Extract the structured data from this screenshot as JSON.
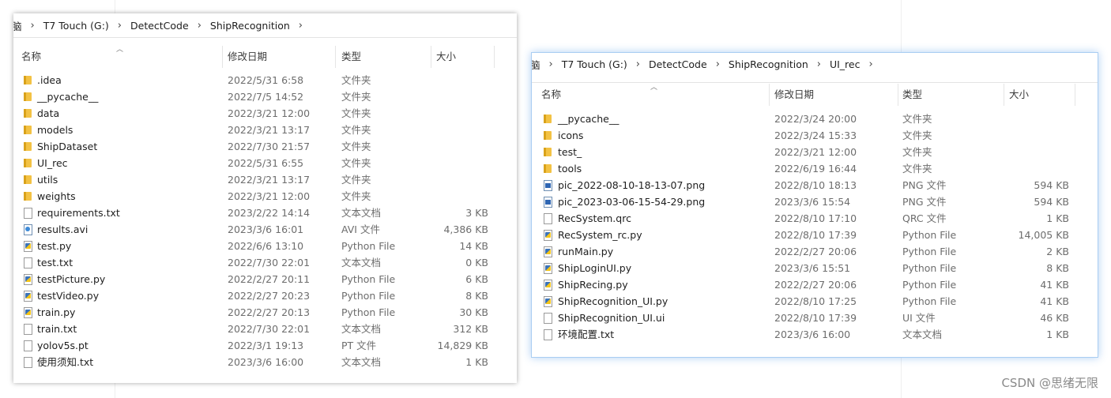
{
  "left": {
    "breadcrumb": [
      "脑",
      "T7 Touch (G:)",
      "DetectCode",
      "ShipRecognition"
    ],
    "columns": {
      "name": "名称",
      "modified": "修改日期",
      "type": "类型",
      "size": "大小"
    },
    "rows": [
      {
        "icon": "folder",
        "name": ".idea",
        "date": "2022/5/31 6:58",
        "type": "文件夹",
        "size": ""
      },
      {
        "icon": "folder",
        "name": "__pycache__",
        "date": "2022/7/5 14:52",
        "type": "文件夹",
        "size": ""
      },
      {
        "icon": "folder",
        "name": "data",
        "date": "2022/3/21 12:00",
        "type": "文件夹",
        "size": ""
      },
      {
        "icon": "folder",
        "name": "models",
        "date": "2022/3/21 13:17",
        "type": "文件夹",
        "size": ""
      },
      {
        "icon": "folder",
        "name": "ShipDataset",
        "date": "2022/7/30 21:57",
        "type": "文件夹",
        "size": ""
      },
      {
        "icon": "folder",
        "name": "UI_rec",
        "date": "2022/5/31 6:55",
        "type": "文件夹",
        "size": ""
      },
      {
        "icon": "folder",
        "name": "utils",
        "date": "2022/3/21 13:17",
        "type": "文件夹",
        "size": ""
      },
      {
        "icon": "folder",
        "name": "weights",
        "date": "2022/3/21 12:00",
        "type": "文件夹",
        "size": ""
      },
      {
        "icon": "doc",
        "name": "requirements.txt",
        "date": "2023/2/22 14:14",
        "type": "文本文档",
        "size": "3 KB"
      },
      {
        "icon": "video",
        "name": "results.avi",
        "date": "2023/3/6 16:01",
        "type": "AVI 文件",
        "size": "4,386 KB"
      },
      {
        "icon": "py",
        "name": "test.py",
        "date": "2022/6/6 13:10",
        "type": "Python File",
        "size": "14 KB"
      },
      {
        "icon": "doc",
        "name": "test.txt",
        "date": "2022/7/30 22:01",
        "type": "文本文档",
        "size": "0 KB"
      },
      {
        "icon": "py",
        "name": "testPicture.py",
        "date": "2022/2/27 20:11",
        "type": "Python File",
        "size": "6 KB"
      },
      {
        "icon": "py",
        "name": "testVideo.py",
        "date": "2022/2/27 20:23",
        "type": "Python File",
        "size": "8 KB"
      },
      {
        "icon": "py",
        "name": "train.py",
        "date": "2022/2/27 20:13",
        "type": "Python File",
        "size": "30 KB"
      },
      {
        "icon": "doc",
        "name": "train.txt",
        "date": "2022/7/30 22:01",
        "type": "文本文档",
        "size": "312 KB"
      },
      {
        "icon": "doc",
        "name": "yolov5s.pt",
        "date": "2022/3/1 19:13",
        "type": "PT 文件",
        "size": "14,829 KB"
      },
      {
        "icon": "doc",
        "name": "使用须知.txt",
        "date": "2023/3/6 16:00",
        "type": "文本文档",
        "size": "1 KB"
      }
    ]
  },
  "right": {
    "breadcrumb": [
      "脑",
      "T7 Touch (G:)",
      "DetectCode",
      "ShipRecognition",
      "UI_rec"
    ],
    "columns": {
      "name": "名称",
      "modified": "修改日期",
      "type": "类型",
      "size": "大小"
    },
    "rows": [
      {
        "icon": "folder",
        "name": "__pycache__",
        "date": "2022/3/24 20:00",
        "type": "文件夹",
        "size": ""
      },
      {
        "icon": "folder",
        "name": "icons",
        "date": "2022/3/24 15:33",
        "type": "文件夹",
        "size": ""
      },
      {
        "icon": "folder",
        "name": "test_",
        "date": "2022/3/21 12:00",
        "type": "文件夹",
        "size": ""
      },
      {
        "icon": "folder",
        "name": "tools",
        "date": "2022/6/19 16:44",
        "type": "文件夹",
        "size": ""
      },
      {
        "icon": "img",
        "name": "pic_2022-08-10-18-13-07.png",
        "date": "2022/8/10 18:13",
        "type": "PNG 文件",
        "size": "594 KB"
      },
      {
        "icon": "img",
        "name": "pic_2023-03-06-15-54-29.png",
        "date": "2023/3/6 15:54",
        "type": "PNG 文件",
        "size": "594 KB"
      },
      {
        "icon": "doc",
        "name": "RecSystem.qrc",
        "date": "2022/8/10 17:10",
        "type": "QRC 文件",
        "size": "1 KB"
      },
      {
        "icon": "py",
        "name": "RecSystem_rc.py",
        "date": "2022/8/10 17:39",
        "type": "Python File",
        "size": "14,005 KB"
      },
      {
        "icon": "py",
        "name": "runMain.py",
        "date": "2022/2/27 20:06",
        "type": "Python File",
        "size": "2 KB"
      },
      {
        "icon": "py",
        "name": "ShipLoginUI.py",
        "date": "2023/3/6 15:51",
        "type": "Python File",
        "size": "8 KB"
      },
      {
        "icon": "py",
        "name": "ShipRecing.py",
        "date": "2022/2/27 20:06",
        "type": "Python File",
        "size": "41 KB"
      },
      {
        "icon": "py",
        "name": "ShipRecognition_UI.py",
        "date": "2022/8/10 17:25",
        "type": "Python File",
        "size": "41 KB"
      },
      {
        "icon": "doc",
        "name": "ShipRecognition_UI.ui",
        "date": "2022/8/10 17:39",
        "type": "UI 文件",
        "size": "46 KB"
      },
      {
        "icon": "doc",
        "name": "环境配置.txt",
        "date": "2023/3/6 16:00",
        "type": "文本文档",
        "size": "1 KB"
      }
    ]
  },
  "watermark": "CSDN @思绪无限",
  "icons": {
    "folder": "folder-icon",
    "doc": "text-file-icon",
    "py": "python-file-icon",
    "img": "png-image-icon",
    "video": "video-file-icon",
    "sort": "sort-up-icon",
    "sep": "chevron-right-icon"
  }
}
